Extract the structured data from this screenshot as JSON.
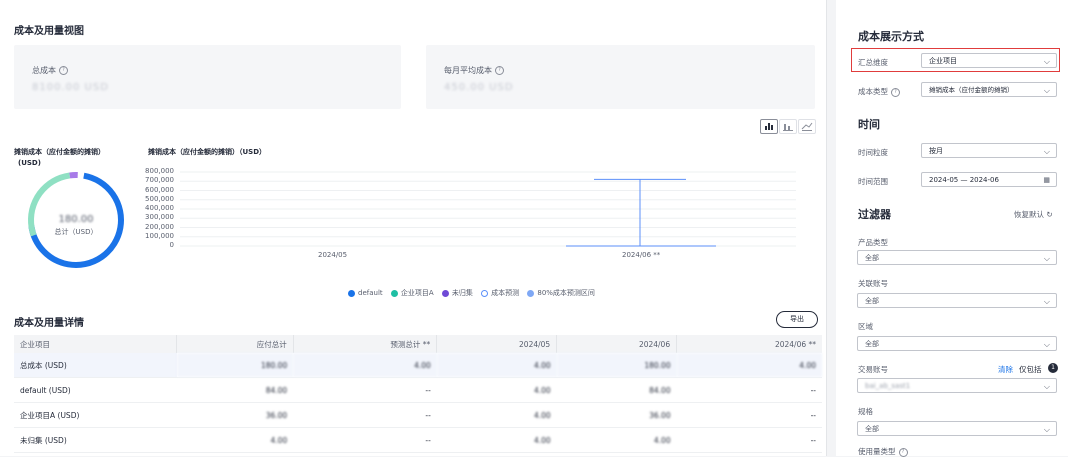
{
  "overview": {
    "title": "成本及用量视图",
    "total_cost_label": "总成本",
    "total_cost_value": "8100.00 USD",
    "monthly_avg_label": "每月平均成本",
    "monthly_avg_value": "450.00 USD"
  },
  "donut": {
    "title": "摊销成本（应付金额的摊销）",
    "unit": "(USD)",
    "center_value": "180.00",
    "center_label": "总计（USD）"
  },
  "chart_data": {
    "type": "bar",
    "title": "摊销成本（应付金额的摊销）（USD）",
    "categories": [
      "2024/05",
      "2024/06 **"
    ],
    "y_ticks": [
      "800,000",
      "700,000",
      "600,000",
      "500,000",
      "400,000",
      "300,000",
      "200,000",
      "100,000",
      "0"
    ],
    "ylim": [
      0,
      800000
    ],
    "series": [
      {
        "name": "default",
        "values": [
          0,
          0
        ]
      },
      {
        "name": "企业项目A",
        "values": [
          0,
          0
        ]
      },
      {
        "name": "未归集",
        "values": [
          0,
          0
        ]
      }
    ],
    "forecast": {
      "name": "成本预测",
      "values": [
        null,
        0
      ]
    },
    "forecast_range": {
      "name": "80%成本预测区间",
      "low": [
        null,
        0
      ],
      "high": [
        null,
        720000
      ]
    },
    "legend_position": "bottom",
    "grid": true
  },
  "colors": {
    "default": "#1a73e8",
    "project_a": "#1fbfa4",
    "unassigned": "#6f4ad6",
    "forecast": "#5b8ff9",
    "range": "#5b8ff9"
  },
  "details": {
    "title": "成本及用量详情",
    "export_label": "导出",
    "columns": [
      "企业项目",
      "应付总计",
      "预测总计 **",
      "2024/05",
      "2024/06",
      "2024/06 **"
    ],
    "rows": [
      [
        "总成本 (USD)",
        "180.00",
        "4.00",
        "4.00",
        "180.00",
        "4.00"
      ],
      [
        "default (USD)",
        "84.00",
        "--",
        "4.00",
        "84.00",
        "--"
      ],
      [
        "企业项目A (USD)",
        "36.00",
        "--",
        "4.00",
        "36.00",
        "--"
      ],
      [
        "未归集 (USD)",
        "4.00",
        "--",
        "4.00",
        "4.00",
        "--"
      ]
    ]
  },
  "panel": {
    "display_title": "成本展示方式",
    "agg_label": "汇总维度",
    "agg_value": "企业项目",
    "cost_type_label": "成本类型",
    "cost_type_value": "摊销成本（应付金额的摊销）",
    "time_title": "时间",
    "granularity_label": "时间粒度",
    "granularity_value": "按月",
    "range_label": "时间范围",
    "range_value": "2024-05 — 2024-06",
    "filter_title": "过滤器",
    "reset_label": "恢复默认",
    "product_type_label": "产品类型",
    "product_type_value": "全部",
    "linked_account_label": "关联账号",
    "linked_account_value": "全部",
    "region_label": "区域",
    "region_value": "全部",
    "tx_account_label": "交易账号",
    "clear_label": "清除",
    "only_include_label": "仅包括",
    "only_include_count": "1",
    "tx_account_value": "bai_ab_sast1",
    "spec_label": "规格",
    "spec_value": "全部",
    "usage_type_label": "使用量类型"
  }
}
